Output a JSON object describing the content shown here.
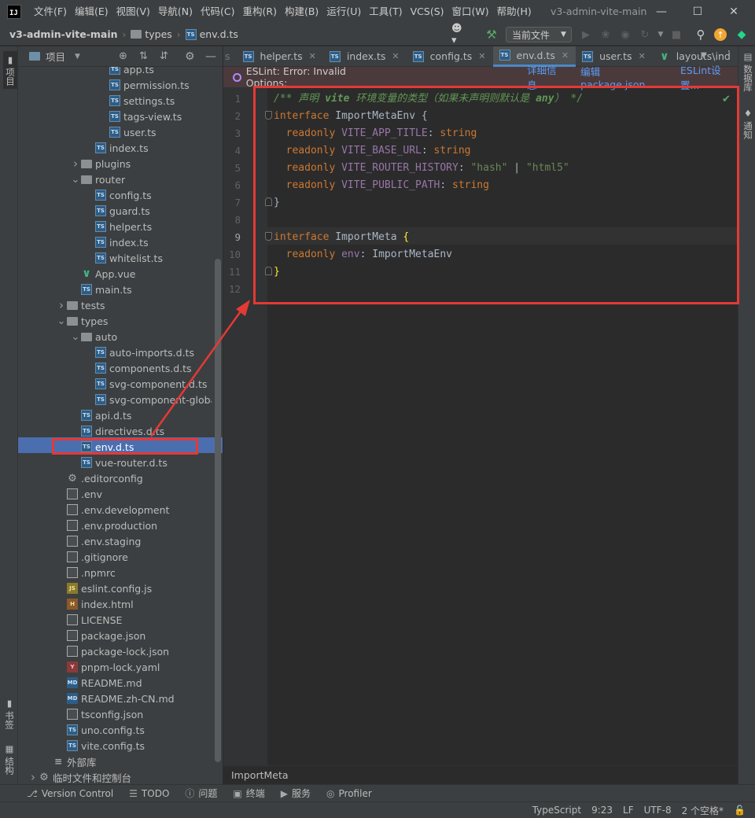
{
  "app": {
    "logo": "IJ",
    "menu": [
      "文件(F)",
      "编辑(E)",
      "视图(V)",
      "导航(N)",
      "代码(C)",
      "重构(R)",
      "构建(B)",
      "运行(U)",
      "工具(T)",
      "VCS(S)",
      "窗口(W)",
      "帮助(H)"
    ],
    "window_title": "v3-admin-vite-main"
  },
  "navbar": {
    "breadcrumb": [
      "v3-admin-vite-main",
      "types",
      "env.d.ts"
    ],
    "run_config": "当前文件"
  },
  "left_strip": {
    "top_tab": "项目",
    "bookmarks_tab": "书签",
    "structure_tab": "结构"
  },
  "right_strip": {
    "database_tab": "数据库",
    "notifications_tab": "通知"
  },
  "project_panel": {
    "title": "项目",
    "tree": [
      {
        "label": "app.ts",
        "icon": "ts",
        "indent": 5,
        "arrow": ""
      },
      {
        "label": "permission.ts",
        "icon": "ts",
        "indent": 5,
        "arrow": ""
      },
      {
        "label": "settings.ts",
        "icon": "ts",
        "indent": 5,
        "arrow": ""
      },
      {
        "label": "tags-view.ts",
        "icon": "ts",
        "indent": 5,
        "arrow": ""
      },
      {
        "label": "user.ts",
        "icon": "ts",
        "indent": 5,
        "arrow": ""
      },
      {
        "label": "index.ts",
        "icon": "ts",
        "indent": 4,
        "arrow": ""
      },
      {
        "label": "plugins",
        "icon": "folder",
        "indent": 3,
        "arrow": "right"
      },
      {
        "label": "router",
        "icon": "folder",
        "indent": 3,
        "arrow": "down"
      },
      {
        "label": "config.ts",
        "icon": "ts",
        "indent": 4,
        "arrow": ""
      },
      {
        "label": "guard.ts",
        "icon": "ts",
        "indent": 4,
        "arrow": ""
      },
      {
        "label": "helper.ts",
        "icon": "ts",
        "indent": 4,
        "arrow": ""
      },
      {
        "label": "index.ts",
        "icon": "ts",
        "indent": 4,
        "arrow": ""
      },
      {
        "label": "whitelist.ts",
        "icon": "ts",
        "indent": 4,
        "arrow": ""
      },
      {
        "label": "App.vue",
        "icon": "vue",
        "indent": 3,
        "arrow": ""
      },
      {
        "label": "main.ts",
        "icon": "ts",
        "indent": 3,
        "arrow": ""
      },
      {
        "label": "tests",
        "icon": "folder",
        "indent": 2,
        "arrow": "right"
      },
      {
        "label": "types",
        "icon": "folder",
        "indent": 2,
        "arrow": "down"
      },
      {
        "label": "auto",
        "icon": "folder",
        "indent": 3,
        "arrow": "down"
      },
      {
        "label": "auto-imports.d.ts",
        "icon": "ts",
        "indent": 4,
        "arrow": ""
      },
      {
        "label": "components.d.ts",
        "icon": "ts",
        "indent": 4,
        "arrow": ""
      },
      {
        "label": "svg-component.d.ts",
        "icon": "ts",
        "indent": 4,
        "arrow": ""
      },
      {
        "label": "svg-component-global.d.ts",
        "icon": "ts",
        "indent": 4,
        "arrow": ""
      },
      {
        "label": "api.d.ts",
        "icon": "ts",
        "indent": 3,
        "arrow": ""
      },
      {
        "label": "directives.d.ts",
        "icon": "ts",
        "indent": 3,
        "arrow": ""
      },
      {
        "label": "env.d.ts",
        "icon": "ts",
        "indent": 3,
        "arrow": "",
        "selected": true
      },
      {
        "label": "vue-router.d.ts",
        "icon": "ts",
        "indent": 3,
        "arrow": ""
      },
      {
        "label": ".editorconfig",
        "icon": "gear",
        "indent": 2,
        "arrow": ""
      },
      {
        "label": ".env",
        "icon": "file",
        "indent": 2,
        "arrow": ""
      },
      {
        "label": ".env.development",
        "icon": "file",
        "indent": 2,
        "arrow": ""
      },
      {
        "label": ".env.production",
        "icon": "file",
        "indent": 2,
        "arrow": ""
      },
      {
        "label": ".env.staging",
        "icon": "file",
        "indent": 2,
        "arrow": ""
      },
      {
        "label": ".gitignore",
        "icon": "file",
        "indent": 2,
        "arrow": ""
      },
      {
        "label": ".npmrc",
        "icon": "file",
        "indent": 2,
        "arrow": ""
      },
      {
        "label": "eslint.config.js",
        "icon": "js",
        "indent": 2,
        "arrow": ""
      },
      {
        "label": "index.html",
        "icon": "html",
        "indent": 2,
        "arrow": ""
      },
      {
        "label": "LICENSE",
        "icon": "file",
        "indent": 2,
        "arrow": ""
      },
      {
        "label": "package.json",
        "icon": "file",
        "indent": 2,
        "arrow": ""
      },
      {
        "label": "package-lock.json",
        "icon": "file",
        "indent": 2,
        "arrow": ""
      },
      {
        "label": "pnpm-lock.yaml",
        "icon": "yml",
        "indent": 2,
        "arrow": ""
      },
      {
        "label": "README.md",
        "icon": "md",
        "indent": 2,
        "arrow": ""
      },
      {
        "label": "README.zh-CN.md",
        "icon": "md",
        "indent": 2,
        "arrow": ""
      },
      {
        "label": "tsconfig.json",
        "icon": "file",
        "indent": 2,
        "arrow": ""
      },
      {
        "label": "uno.config.ts",
        "icon": "ts",
        "indent": 2,
        "arrow": ""
      },
      {
        "label": "vite.config.ts",
        "icon": "ts",
        "indent": 2,
        "arrow": ""
      },
      {
        "label": "外部库",
        "icon": "lib",
        "indent": 1,
        "arrow": ""
      },
      {
        "label": "临时文件和控制台",
        "icon": "gear",
        "indent": 0,
        "arrow": "right"
      }
    ]
  },
  "tabs": [
    {
      "label": "s",
      "icon": "",
      "active": false,
      "close": false
    },
    {
      "label": "helper.ts",
      "icon": "ts",
      "active": false,
      "close": true
    },
    {
      "label": "index.ts",
      "icon": "ts",
      "active": false,
      "close": true
    },
    {
      "label": "config.ts",
      "icon": "ts",
      "active": false,
      "close": true
    },
    {
      "label": "env.d.ts",
      "icon": "ts",
      "active": true,
      "close": true
    },
    {
      "label": "user.ts",
      "icon": "ts",
      "active": false,
      "close": true
    },
    {
      "label": "layouts\\ind",
      "icon": "vue",
      "active": false,
      "close": false
    }
  ],
  "eslint_bar": {
    "message": "ESLint: Error: Invalid Options:",
    "details_link": "详细信息",
    "edit_link": "编辑 package.json",
    "settings_link": "ESLint设置..."
  },
  "code_lines": [
    {
      "n": "1",
      "html": "<span class=\"cm\">/** 声明 </span><span class=\"cmt\">vite</span><span class=\"cm\"> 环境变量的类型（如果未声明则默认是 </span><span class=\"cmt\">any</span><span class=\"cm\">） */</span>"
    },
    {
      "n": "2",
      "html": "<span class=\"kw\">interface</span> <span class=\"ty\">ImportMetaEnv</span> {"
    },
    {
      "n": "3",
      "html": "  <span class=\"kw\">readonly</span> <span class=\"prop\">VITE_APP_TITLE</span>: <span class=\"kw\">string</span>"
    },
    {
      "n": "4",
      "html": "  <span class=\"kw\">readonly</span> <span class=\"prop\">VITE_BASE_URL</span>: <span class=\"kw\">string</span>"
    },
    {
      "n": "5",
      "html": "  <span class=\"kw\">readonly</span> <span class=\"prop\">VITE_ROUTER_HISTORY</span>: <span class=\"str\">\"hash\"</span> | <span class=\"str\">\"html5\"</span>"
    },
    {
      "n": "6",
      "html": "  <span class=\"kw\">readonly</span> <span class=\"prop\">VITE_PUBLIC_PATH</span>: <span class=\"kw\">string</span>"
    },
    {
      "n": "7",
      "html": "}"
    },
    {
      "n": "8",
      "html": ""
    },
    {
      "n": "9",
      "html": "<span class=\"kw\">interface</span> <span class=\"ty\">ImportMeta</span> <span class=\"brk\">{</span>"
    },
    {
      "n": "10",
      "html": "  <span class=\"kw\">readonly</span> <span class=\"prop\">env</span>: <span class=\"ty\">ImportMetaEnv</span>"
    },
    {
      "n": "11",
      "html": "<span class=\"brk\">}</span>"
    },
    {
      "n": "12",
      "html": ""
    }
  ],
  "editor_breadcrumb": "ImportMeta",
  "bottom_tools": [
    "Version Control",
    "TODO",
    "问题",
    "终端",
    "服务",
    "Profiler"
  ],
  "status": {
    "language": "TypeScript",
    "position": "9:23",
    "line_sep": "LF",
    "encoding": "UTF-8",
    "indent": "2 个空格*"
  },
  "colors": {
    "accent": "#4a88c7",
    "selection": "#4b6eaf",
    "annotation": "#e53935"
  }
}
